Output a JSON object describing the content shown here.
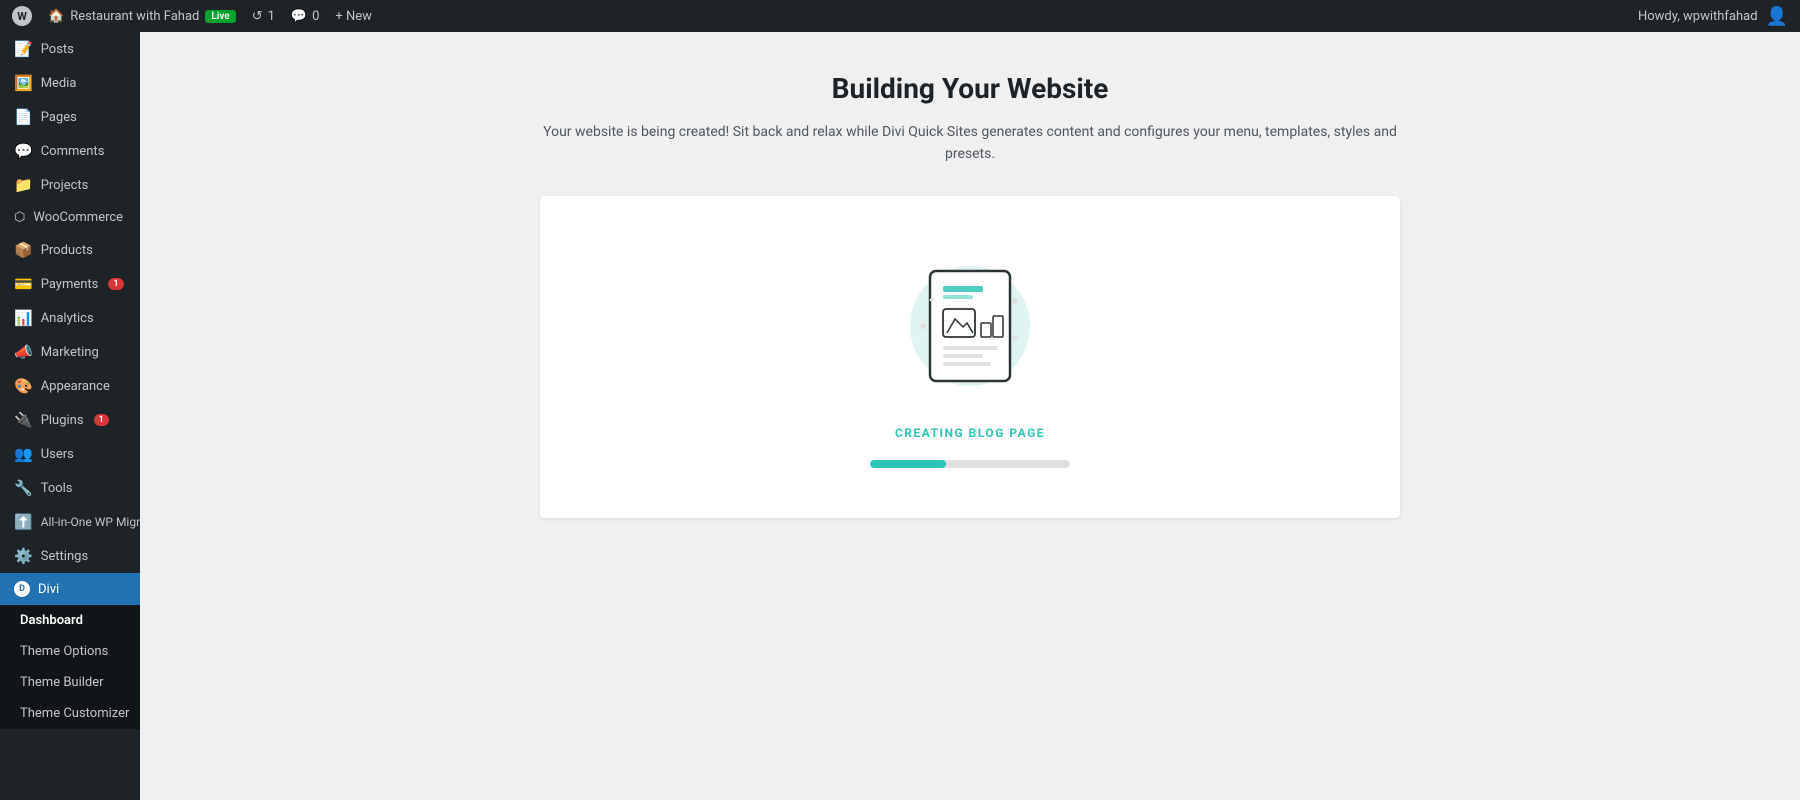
{
  "adminBar": {
    "wpLogo": "W",
    "siteName": "Restaurant with Fahad",
    "liveBadge": "Live",
    "revisions": "1",
    "comments": "0",
    "newLabel": "+ New",
    "userGreeting": "Howdy, wpwithfahad"
  },
  "sidebar": {
    "items": [
      {
        "id": "posts",
        "label": "Posts",
        "icon": "📝"
      },
      {
        "id": "media",
        "label": "Media",
        "icon": "🖼️"
      },
      {
        "id": "pages",
        "label": "Pages",
        "icon": "📄"
      },
      {
        "id": "comments",
        "label": "Comments",
        "icon": "💬"
      },
      {
        "id": "projects",
        "label": "Projects",
        "icon": "📁"
      },
      {
        "id": "woocommerce",
        "label": "WooCommerce",
        "icon": "🛒"
      },
      {
        "id": "products",
        "label": "Products",
        "icon": "📦"
      },
      {
        "id": "payments",
        "label": "Payments",
        "icon": "💳",
        "badge": "1"
      },
      {
        "id": "analytics",
        "label": "Analytics",
        "icon": "📊"
      },
      {
        "id": "marketing",
        "label": "Marketing",
        "icon": "📣"
      },
      {
        "id": "appearance",
        "label": "Appearance",
        "icon": "🎨"
      },
      {
        "id": "plugins",
        "label": "Plugins",
        "icon": "🔌",
        "badge": "1"
      },
      {
        "id": "users",
        "label": "Users",
        "icon": "👥"
      },
      {
        "id": "tools",
        "label": "Tools",
        "icon": "🔧"
      },
      {
        "id": "all-in-one",
        "label": "All-in-One WP Migration",
        "icon": "⬆️"
      },
      {
        "id": "settings",
        "label": "Settings",
        "icon": "⚙️"
      }
    ],
    "diviItem": {
      "label": "Divi",
      "icon": "D"
    },
    "submenu": [
      {
        "id": "dashboard",
        "label": "Dashboard",
        "active": true
      },
      {
        "id": "theme-options",
        "label": "Theme Options"
      },
      {
        "id": "theme-builder",
        "label": "Theme Builder"
      },
      {
        "id": "theme-customizer",
        "label": "Theme Customizer"
      }
    ]
  },
  "main": {
    "title": "Building Your Website",
    "subtitle": "Your website is being created! Sit back and relax while Divi Quick Sites generates content and configures your menu, templates, styles and presets.",
    "statusText": "CREATING BLOG PAGE",
    "progressPercent": 38,
    "progressWidth": "38%"
  }
}
